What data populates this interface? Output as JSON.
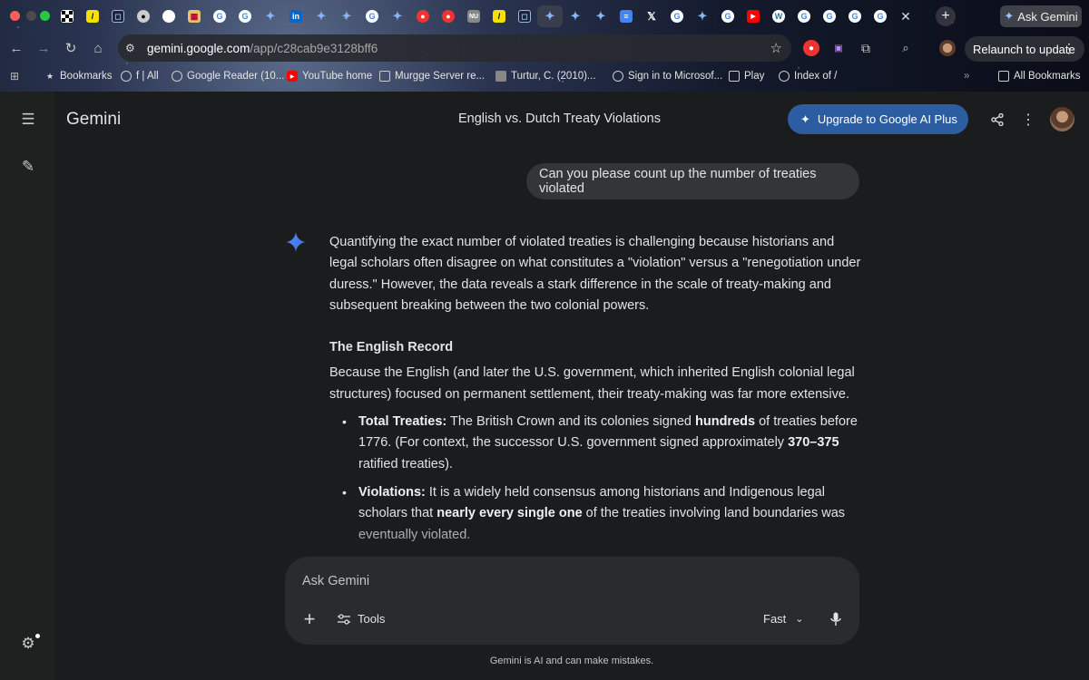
{
  "browser": {
    "tab_close_glyph": "✕",
    "new_tab_glyph": "+",
    "ask_gemini_label": "Ask Gemini",
    "url_host": "gemini.google.com",
    "url_path": "/app/c28cab9e3128bff6",
    "relaunch_label": "Relaunch to update",
    "bookmarks": [
      {
        "label": "Bookmarks",
        "icon": "star-icon"
      },
      {
        "label": "f | All",
        "icon": "globe-icon"
      },
      {
        "label": "Google Reader (10...",
        "icon": "globe-icon"
      },
      {
        "label": "YouTube home",
        "icon": "youtube-icon"
      },
      {
        "label": "Murgge Server re...",
        "icon": "folder-icon"
      },
      {
        "label": "Turtur, C. (2010)...",
        "icon": "document-icon"
      },
      {
        "label": "Sign in to Microsof...",
        "icon": "globe-icon"
      },
      {
        "label": "Play",
        "icon": "folder-icon"
      },
      {
        "label": "Index of /",
        "icon": "globe-icon"
      },
      {
        "label": "All Bookmarks",
        "icon": "folder-icon"
      }
    ]
  },
  "app": {
    "brand": "Gemini",
    "conversation_title": "English vs. Dutch Treaty Violations",
    "upgrade_label": "Upgrade to Google AI Plus",
    "accent_color": "#2c5da0"
  },
  "conversation": {
    "user_message": "Can you please count up the number of treaties violated",
    "response": {
      "intro": "Quantifying the exact number of violated treaties is challenging because historians and legal scholars often disagree on what constitutes a \"violation\" versus a \"renegotiation under duress.\" However, the data reveals a stark difference in the scale of treaty-making and subsequent breaking between the two colonial powers.",
      "section_heading": "The English Record",
      "section_body": "Because the English (and later the U.S. government, which inherited English colonial legal structures) focused on permanent settlement, their treaty-making was far more extensive.",
      "bullets": [
        {
          "label": "Total Treaties:",
          "t1": " The British Crown and its colonies signed ",
          "b1": "hundreds",
          "t2": " of treaties before 1776. (For context, the successor U.S. government signed approximately ",
          "b2": "370–375",
          "t3": " ratified treaties)."
        },
        {
          "label": "Violations:",
          "t1": " It is a widely held consensus among historians and Indigenous legal scholars that ",
          "b1": "nearly every single one",
          "t2": " of the treaties involving land boundaries was eventually violated."
        }
      ]
    }
  },
  "composer": {
    "placeholder": "Ask Gemini",
    "tools_label": "Tools",
    "mode_label": "Fast"
  },
  "footer": {
    "disclaimer": "Gemini is AI and can make mistakes."
  }
}
